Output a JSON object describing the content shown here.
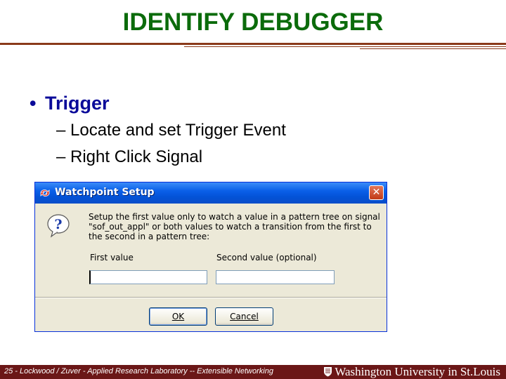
{
  "slide": {
    "title": "IDENTIFY DEBUGGER",
    "bullet": "Trigger",
    "subs": [
      "– Locate and set Trigger Event",
      "– Right Click Signal"
    ]
  },
  "dialog": {
    "title": "Watchpoint Setup",
    "close_label": "✕",
    "message": "Setup the first value only to watch a value in a pattern tree on signal \"sof_out_appl\" or both values to watch a transition from the first to the second in a pattern tree:",
    "first_label": "First value",
    "second_label": "Second value (optional)",
    "first_value": "",
    "second_value": "",
    "ok_label": "OK",
    "cancel_label": "Cancel"
  },
  "footer": {
    "left": "25 - Lockwood / Zuver - Applied Research Laboratory -- Extensible Networking",
    "right": "Washington University in St.Louis"
  },
  "colors": {
    "title": "#0b6b0b",
    "bullet": "#0a0a99",
    "footer": "#6b1717"
  },
  "icons": [
    "app-icon",
    "close-icon",
    "question-icon",
    "shield-icon"
  ]
}
